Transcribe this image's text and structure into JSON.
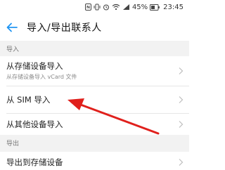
{
  "status_bar": {
    "battery_text": "45%",
    "time": "23:45",
    "icons": [
      "nfc-icon",
      "vibrate-icon",
      "alarm-icon",
      "wifi-icon",
      "signal-icon",
      "battery-icon"
    ]
  },
  "header": {
    "title": "导入/导出联系人",
    "back_icon": "back-arrow-icon"
  },
  "sections": [
    {
      "header": "导入",
      "items": [
        {
          "title": "从存储设备导入",
          "subtitle": "从存储设备导入 vCard 文件"
        },
        {
          "title": "从 SIM 导入"
        },
        {
          "title": "从其他设备导入"
        }
      ]
    },
    {
      "header": "导出",
      "items": [
        {
          "title": "导出到存储设备"
        }
      ]
    }
  ],
  "colors": {
    "accent": "#2196f3",
    "annotation_arrow": "#e0201c",
    "section_bg": "#f2f2f2"
  }
}
